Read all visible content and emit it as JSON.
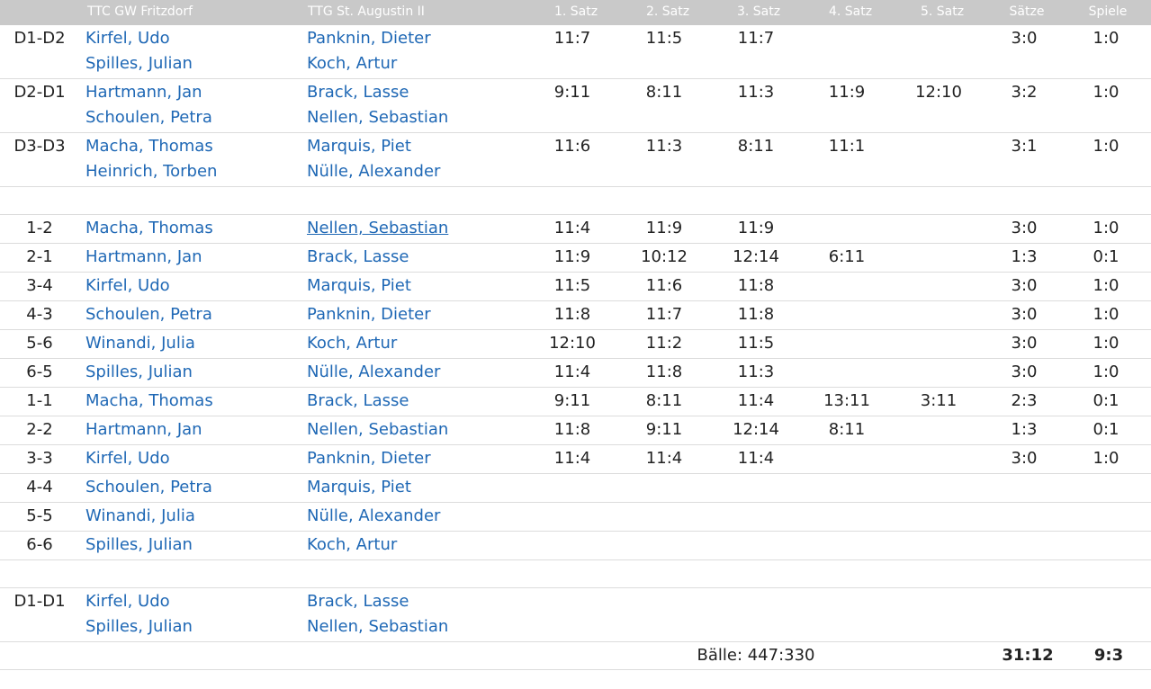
{
  "header": {
    "home_team": "TTC GW Fritzdorf",
    "away_team": "TTG St. Augustin II",
    "sets": [
      "1. Satz",
      "2. Satz",
      "3. Satz",
      "4. Satz",
      "5. Satz"
    ],
    "saetze": "Sätze",
    "spiele": "Spiele"
  },
  "doubles_1": [
    {
      "pair": "D1-D2",
      "home": [
        "Kirfel, Udo",
        "Spilles, Julian"
      ],
      "away": [
        "Panknin, Dieter",
        "Koch, Artur"
      ],
      "sets": [
        "11:7",
        "11:5",
        "11:7",
        "",
        ""
      ],
      "saetze": "3:0",
      "spiele": "1:0"
    },
    {
      "pair": "D2-D1",
      "home": [
        "Hartmann, Jan",
        "Schoulen, Petra"
      ],
      "away": [
        "Brack, Lasse",
        "Nellen, Sebastian"
      ],
      "sets": [
        "9:11",
        "8:11",
        "11:3",
        "11:9",
        "12:10"
      ],
      "saetze": "3:2",
      "spiele": "1:0"
    },
    {
      "pair": "D3-D3",
      "home": [
        "Macha, Thomas",
        "Heinrich, Torben"
      ],
      "away": [
        "Marquis, Piet",
        "Nülle, Alexander"
      ],
      "sets": [
        "11:6",
        "11:3",
        "8:11",
        "11:1",
        ""
      ],
      "saetze": "3:1",
      "spiele": "1:0"
    }
  ],
  "singles": [
    {
      "pair": "1-2",
      "home": "Macha, Thomas",
      "away": "Nellen, Sebastian",
      "away_underlined": true,
      "sets": [
        "11:4",
        "11:9",
        "11:9",
        "",
        ""
      ],
      "saetze": "3:0",
      "spiele": "1:0"
    },
    {
      "pair": "2-1",
      "home": "Hartmann, Jan",
      "away": "Brack, Lasse",
      "sets": [
        "11:9",
        "10:12",
        "12:14",
        "6:11",
        ""
      ],
      "saetze": "1:3",
      "spiele": "0:1"
    },
    {
      "pair": "3-4",
      "home": "Kirfel, Udo",
      "away": "Marquis, Piet",
      "sets": [
        "11:5",
        "11:6",
        "11:8",
        "",
        ""
      ],
      "saetze": "3:0",
      "spiele": "1:0"
    },
    {
      "pair": "4-3",
      "home": "Schoulen, Petra",
      "away": "Panknin, Dieter",
      "sets": [
        "11:8",
        "11:7",
        "11:8",
        "",
        ""
      ],
      "saetze": "3:0",
      "spiele": "1:0"
    },
    {
      "pair": "5-6",
      "home": "Winandi, Julia",
      "away": "Koch, Artur",
      "sets": [
        "12:10",
        "11:2",
        "11:5",
        "",
        ""
      ],
      "saetze": "3:0",
      "spiele": "1:0"
    },
    {
      "pair": "6-5",
      "home": "Spilles, Julian",
      "away": "Nülle, Alexander",
      "sets": [
        "11:4",
        "11:8",
        "11:3",
        "",
        ""
      ],
      "saetze": "3:0",
      "spiele": "1:0"
    },
    {
      "pair": "1-1",
      "home": "Macha, Thomas",
      "away": "Brack, Lasse",
      "sets": [
        "9:11",
        "8:11",
        "11:4",
        "13:11",
        "3:11"
      ],
      "saetze": "2:3",
      "spiele": "0:1"
    },
    {
      "pair": "2-2",
      "home": "Hartmann, Jan",
      "away": "Nellen, Sebastian",
      "sets": [
        "11:8",
        "9:11",
        "12:14",
        "8:11",
        ""
      ],
      "saetze": "1:3",
      "spiele": "0:1"
    },
    {
      "pair": "3-3",
      "home": "Kirfel, Udo",
      "away": "Panknin, Dieter",
      "sets": [
        "11:4",
        "11:4",
        "11:4",
        "",
        ""
      ],
      "saetze": "3:0",
      "spiele": "1:0"
    },
    {
      "pair": "4-4",
      "home": "Schoulen, Petra",
      "away": "Marquis, Piet",
      "sets": [
        "",
        "",
        "",
        "",
        ""
      ],
      "saetze": "",
      "spiele": ""
    },
    {
      "pair": "5-5",
      "home": "Winandi, Julia",
      "away": "Nülle, Alexander",
      "sets": [
        "",
        "",
        "",
        "",
        ""
      ],
      "saetze": "",
      "spiele": ""
    },
    {
      "pair": "6-6",
      "home": "Spilles, Julian",
      "away": "Koch, Artur",
      "sets": [
        "",
        "",
        "",
        "",
        ""
      ],
      "saetze": "",
      "spiele": ""
    }
  ],
  "doubles_2": [
    {
      "pair": "D1-D1",
      "home": [
        "Kirfel, Udo",
        "Spilles, Julian"
      ],
      "away": [
        "Brack, Lasse",
        "Nellen, Sebastian"
      ],
      "sets": [
        "",
        "",
        "",
        "",
        ""
      ],
      "saetze": "",
      "spiele": ""
    }
  ],
  "totals": {
    "baelle": "Bälle: 447:330",
    "saetze": "31:12",
    "spiele": "9:3"
  }
}
